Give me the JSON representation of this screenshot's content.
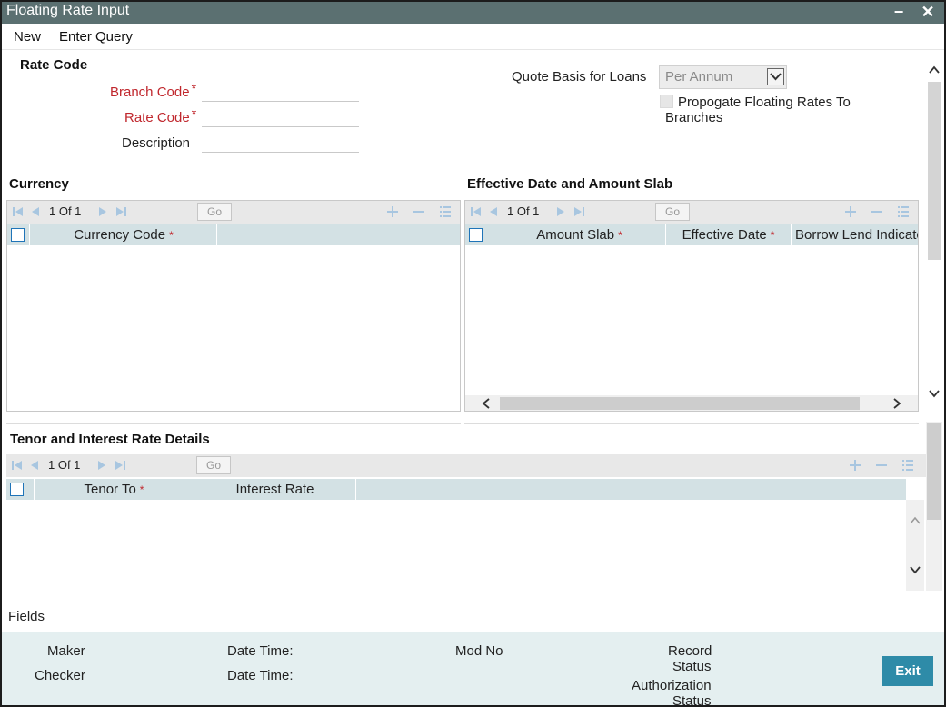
{
  "window": {
    "title": "Floating Rate Input",
    "minimize": "−",
    "close": "✕"
  },
  "menu": {
    "new": "New",
    "enter_query": "Enter Query"
  },
  "rate_code_section": {
    "title": "Rate Code",
    "branch_code_label": "Branch Code",
    "branch_code_value": "",
    "rate_code_label": "Rate Code",
    "rate_code_value": "",
    "description_label": "Description",
    "description_value": "",
    "required_marker": "*"
  },
  "quote_basis": {
    "label": "Quote Basis for Loans",
    "selected": "Per Annum"
  },
  "propagate": {
    "label_line1": "Propogate Floating Rates To",
    "label_line2": "Branches",
    "checked": false
  },
  "currency_grid": {
    "title": "Currency",
    "page_text": "1 Of 1",
    "go": "Go",
    "columns": [
      "Currency Code"
    ],
    "rows": []
  },
  "effective_grid": {
    "title": "Effective Date and Amount Slab",
    "page_text": "1 Of 1",
    "go": "Go",
    "columns": [
      "Amount Slab",
      "Effective Date",
      "Borrow Lend Indicato"
    ],
    "rows": []
  },
  "tenor_grid": {
    "title": "Tenor and Interest Rate Details",
    "page_text": "1 Of 1",
    "go": "Go",
    "columns": [
      "Tenor To",
      "Interest Rate"
    ],
    "rows": []
  },
  "fields_label": "Fields",
  "audit": {
    "maker": "Maker",
    "checker": "Checker",
    "date_time_1": "Date Time:",
    "date_time_2": "Date Time:",
    "mod_no": "Mod No",
    "record_status_1": "Record",
    "record_status_2": "Status",
    "auth_status_1": "Authorization",
    "auth_status_2": "Status",
    "exit": "Exit"
  },
  "colors": {
    "titlebar": "#5b7071",
    "grid_header": "#d3e1e4",
    "footer": "#e4eff0",
    "exit_button": "#2e8ba8",
    "required": "#c0272d"
  }
}
